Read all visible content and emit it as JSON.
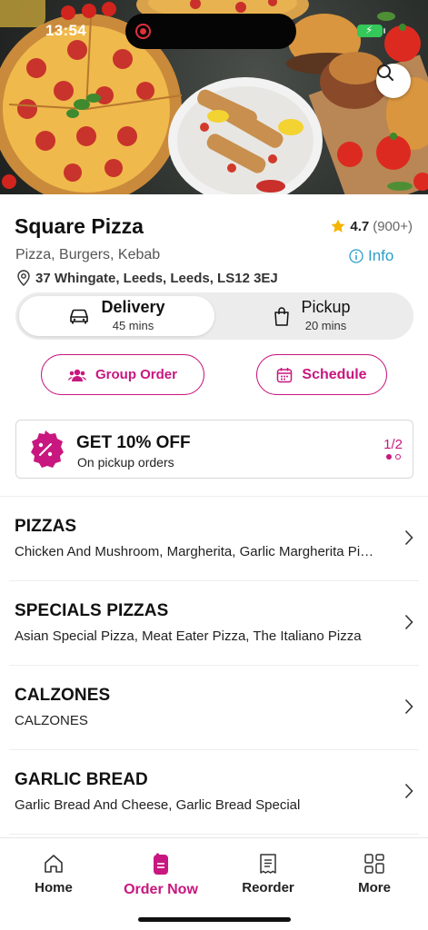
{
  "status_bar": {
    "time": "13:54"
  },
  "restaurant": {
    "name": "Square Pizza",
    "rating": "4.7",
    "rating_count": "(900+)",
    "cuisine": "Pizza, Burgers, Kebab",
    "info_label": "Info",
    "address": "37 Whingate, Leeds, Leeds, LS12 3EJ"
  },
  "order_modes": {
    "delivery": {
      "label": "Delivery",
      "time": "45 mins",
      "selected": true
    },
    "pickup": {
      "label": "Pickup",
      "time": "20 mins",
      "selected": false
    }
  },
  "actions": {
    "group_order": "Group Order",
    "schedule": "Schedule"
  },
  "promo": {
    "title": "GET 10% OFF",
    "subtitle": "On pickup orders",
    "pager": "1/2"
  },
  "categories": [
    {
      "title": "PIZZAS",
      "items": "Chicken And Mushroom, Margherita, Garlic Margherita Pizza"
    },
    {
      "title": "SPECIALS PIZZAS",
      "items": "Asian Special Pizza, Meat Eater Pizza, The Italiano Pizza"
    },
    {
      "title": "CALZONES",
      "items": "CALZONES"
    },
    {
      "title": "GARLIC BREAD",
      "items": "Garlic Bread And Cheese, Garlic Bread Special"
    }
  ],
  "nav": [
    {
      "label": "Home",
      "icon": "home-icon"
    },
    {
      "label": "Order Now",
      "icon": "order-icon",
      "active": true
    },
    {
      "label": "Reorder",
      "icon": "receipt-icon"
    },
    {
      "label": "More",
      "icon": "grid-icon"
    }
  ],
  "colors": {
    "accent": "#c8177e",
    "link": "#2a9fc9",
    "star": "#f5b400"
  }
}
